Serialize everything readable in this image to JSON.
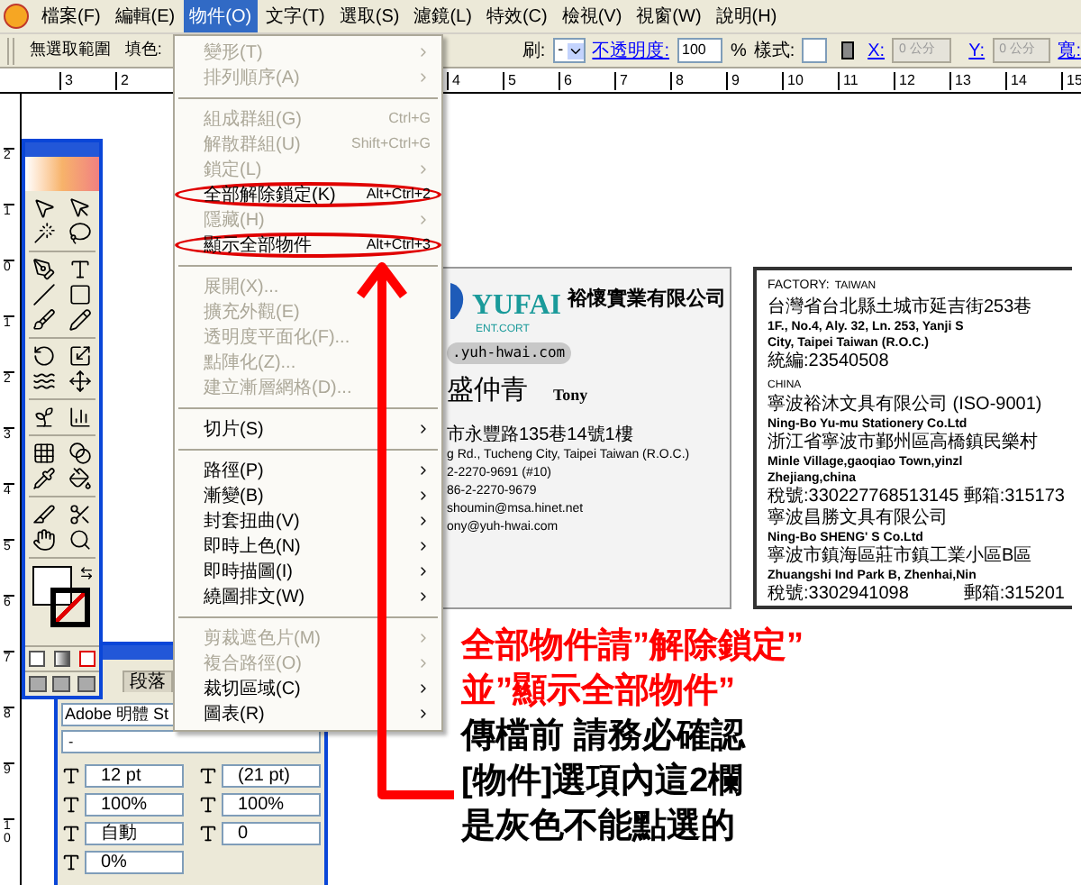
{
  "menubar": {
    "items": [
      {
        "label": "檔案(F)",
        "selected": false
      },
      {
        "label": "編輯(E)",
        "selected": false
      },
      {
        "label": "物件(O)",
        "selected": true
      },
      {
        "label": "文字(T)",
        "selected": false
      },
      {
        "label": "選取(S)",
        "selected": false
      },
      {
        "label": "濾鏡(L)",
        "selected": false
      },
      {
        "label": "特效(C)",
        "selected": false
      },
      {
        "label": "檢視(V)",
        "selected": false
      },
      {
        "label": "視窗(W)",
        "selected": false
      },
      {
        "label": "說明(H)",
        "selected": false
      }
    ]
  },
  "control_bar": {
    "selection": "無選取範圍",
    "fill_label": "填色:",
    "brush_label": "刷:",
    "brush_value": "-",
    "opacity_label": "不透明度:",
    "opacity_value": "100",
    "opacity_unit": "%",
    "style_label": "樣式:",
    "x_label": "X:",
    "x_value": "0 公分",
    "y_label": "Y:",
    "y_value": "0 公分",
    "width_label": "寬:"
  },
  "ruler": {
    "left_numbers": [
      "3",
      "2"
    ],
    "right_numbers": [
      "4",
      "5",
      "6",
      "7",
      "8",
      "9",
      "10",
      "11",
      "12",
      "13",
      "14",
      "15"
    ],
    "vertical_numbers": [
      "2",
      "1",
      "0",
      "1",
      "2",
      "3",
      "4",
      "5",
      "6",
      "7",
      "8",
      "9",
      "10"
    ]
  },
  "object_menu": {
    "items": [
      {
        "kind": "item",
        "label": "變形(T)",
        "disabled": true,
        "submenu": true,
        "circled": false
      },
      {
        "kind": "item",
        "label": "排列順序(A)",
        "disabled": true,
        "submenu": true,
        "circled": false
      },
      {
        "kind": "separator"
      },
      {
        "kind": "item",
        "label": "組成群組(G)",
        "shortcut": "Ctrl+G",
        "disabled": true,
        "submenu": false,
        "circled": false
      },
      {
        "kind": "item",
        "label": "解散群組(U)",
        "shortcut": "Shift+Ctrl+G",
        "disabled": true,
        "submenu": false,
        "circled": false
      },
      {
        "kind": "item",
        "label": "鎖定(L)",
        "disabled": true,
        "submenu": true,
        "circled": false
      },
      {
        "kind": "item",
        "label": "全部解除鎖定(K)",
        "shortcut": "Alt+Ctrl+2",
        "disabled": false,
        "submenu": false,
        "circled": true
      },
      {
        "kind": "item",
        "label": "隱藏(H)",
        "disabled": true,
        "submenu": true,
        "circled": false
      },
      {
        "kind": "item",
        "label": "顯示全部物件",
        "shortcut": "Alt+Ctrl+3",
        "disabled": false,
        "submenu": false,
        "circled": true
      },
      {
        "kind": "separator"
      },
      {
        "kind": "item",
        "label": "展開(X)...",
        "disabled": true,
        "submenu": false,
        "circled": false
      },
      {
        "kind": "item",
        "label": "擴充外觀(E)",
        "disabled": true,
        "submenu": false,
        "circled": false
      },
      {
        "kind": "item",
        "label": "透明度平面化(F)...",
        "disabled": true,
        "submenu": false,
        "circled": false
      },
      {
        "kind": "item",
        "label": "點陣化(Z)...",
        "disabled": true,
        "submenu": false,
        "circled": false
      },
      {
        "kind": "item",
        "label": "建立漸層網格(D)...",
        "disabled": true,
        "submenu": false,
        "circled": false
      },
      {
        "kind": "separator"
      },
      {
        "kind": "item",
        "label": "切片(S)",
        "disabled": false,
        "submenu": true,
        "circled": false
      },
      {
        "kind": "separator"
      },
      {
        "kind": "item",
        "label": "路徑(P)",
        "disabled": false,
        "submenu": true,
        "circled": false
      },
      {
        "kind": "item",
        "label": "漸變(B)",
        "disabled": false,
        "submenu": true,
        "circled": false
      },
      {
        "kind": "item",
        "label": "封套扭曲(V)",
        "disabled": false,
        "submenu": true,
        "circled": false
      },
      {
        "kind": "item",
        "label": "即時上色(N)",
        "disabled": false,
        "submenu": true,
        "circled": false
      },
      {
        "kind": "item",
        "label": "即時描圖(I)",
        "disabled": false,
        "submenu": true,
        "circled": false
      },
      {
        "kind": "item",
        "label": "繞圖排文(W)",
        "disabled": false,
        "submenu": true,
        "circled": false
      },
      {
        "kind": "separator"
      },
      {
        "kind": "item",
        "label": "剪裁遮色片(M)",
        "disabled": true,
        "submenu": true,
        "circled": false
      },
      {
        "kind": "item",
        "label": "複合路徑(O)",
        "disabled": true,
        "submenu": true,
        "circled": false
      },
      {
        "kind": "item",
        "label": "裁切區域(C)",
        "disabled": false,
        "submenu": true,
        "circled": false
      },
      {
        "kind": "item",
        "label": "圖表(R)",
        "disabled": false,
        "submenu": true,
        "circled": false
      }
    ]
  },
  "character_panel": {
    "tabs": [
      {
        "label": "段落",
        "selected": false
      }
    ],
    "font": "Adobe 明體 St",
    "style": "-",
    "fields": [
      {
        "value": "12 pt"
      },
      {
        "value": "(21 pt)"
      },
      {
        "value": "100%"
      },
      {
        "value": "100%"
      },
      {
        "value": "自動"
      },
      {
        "value": "0"
      },
      {
        "value": "0%"
      }
    ]
  },
  "front_card": {
    "company": "裕懷實業有限公司",
    "logo_text": "YUFAI",
    "logo_sub": "ENT.CORT",
    "website": ".yuh-hwai.com",
    "name": "盛仲青",
    "english_name": "Tony",
    "lines": [
      "市永豐路135巷14號1樓",
      "g Rd., Tucheng City, Taipei Taiwan (R.O.C.)",
      "2-2270-9691 (#10)",
      "86-2-2270-9679",
      "shoumin@msa.hinet.net",
      "ony@yuh-hwai.com"
    ]
  },
  "back_card": {
    "label": "FACTORY:",
    "region": "TAIWAN",
    "lines": [
      {
        "kind": "cjk",
        "text": "台灣省台北縣土城市延吉街253巷"
      },
      {
        "kind": "latin",
        "text": "1F., No.4, Aly. 32, Ln. 253, Yanji S"
      },
      {
        "kind": "latin",
        "text": "City, Taipei Taiwan (R.O.C.)"
      },
      {
        "kind": "cjk",
        "text": "統編:23540508"
      },
      {
        "kind": "heading",
        "text": "CHINA"
      },
      {
        "kind": "cjk",
        "text": "寧波裕沐文具有限公司 (ISO-9001)"
      },
      {
        "kind": "latin",
        "text": "Ning-Bo Yu-mu Stationery Co.Ltd"
      },
      {
        "kind": "cjk",
        "text": "浙江省寧波市鄞州區高橋鎮民樂村"
      },
      {
        "kind": "latin",
        "text": "Minle Village,gaoqiao Town,yinzl"
      },
      {
        "kind": "latin",
        "text": "Zhejiang,china"
      },
      {
        "kind": "pair",
        "text": "稅號:330227768513145",
        "right": "郵箱:315173"
      },
      {
        "kind": "cjk",
        "text": "寧波昌勝文具有限公司"
      },
      {
        "kind": "latin",
        "text": "Ning-Bo SHENG' S Co.Ltd"
      },
      {
        "kind": "cjk",
        "text": "寧波市鎮海區莊市鎮工業小區B區"
      },
      {
        "kind": "latin",
        "text": "Zhuangshi Ind Park B, Zhenhai,Nin"
      },
      {
        "kind": "pair",
        "text": "稅號:3302941098",
        "right": "郵箱:315201"
      }
    ]
  },
  "annotation": {
    "lines": [
      {
        "text": "全部物件請”解除鎖定”",
        "color": "#ff0000"
      },
      {
        "text": "並”顯示全部物件”",
        "color": "#ff0000"
      },
      {
        "text": "傳檔前  請務必確認",
        "color": "#000000"
      },
      {
        "text": "[物件]選項內這2欄",
        "color": "#000000"
      },
      {
        "text": "是灰色不能點選的",
        "color": "#000000"
      }
    ]
  }
}
